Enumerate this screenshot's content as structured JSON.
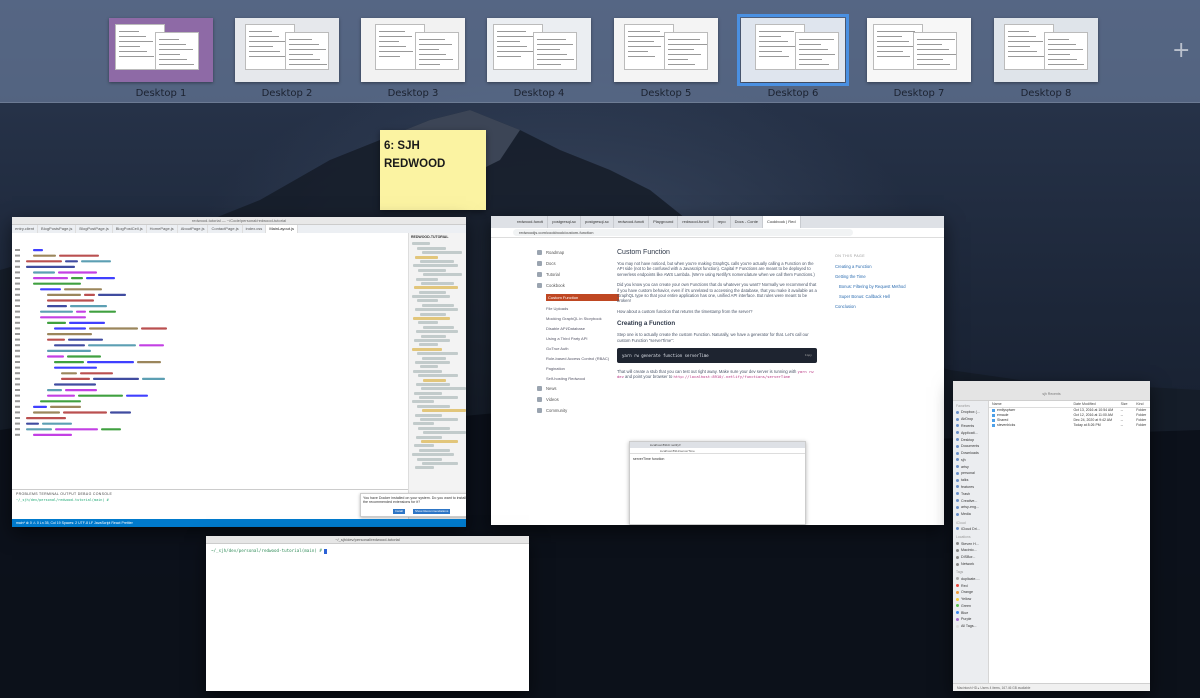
{
  "spaces": {
    "desktops": [
      {
        "label": "Desktop 1",
        "active": false,
        "tint": "#8e6aa6"
      },
      {
        "label": "Desktop 2",
        "active": false,
        "tint": "#e6e8ec"
      },
      {
        "label": "Desktop 3",
        "active": false,
        "tint": "#f2f2f2"
      },
      {
        "label": "Desktop 4",
        "active": false,
        "tint": "#ebeef2"
      },
      {
        "label": "Desktop 5",
        "active": false,
        "tint": "#f4f4f4"
      },
      {
        "label": "Desktop 6",
        "active": true,
        "tint": "#dfe5ee"
      },
      {
        "label": "Desktop 7",
        "active": false,
        "tint": "#f7f7f7"
      },
      {
        "label": "Desktop 8",
        "active": false,
        "tint": "#dfe4ea"
      }
    ],
    "add_icon": "plus-icon",
    "add_glyph": "+"
  },
  "sticky": {
    "text": "6: SJH REDWOOD"
  },
  "vscode": {
    "title": "redwood-tutorial — ~/Code/personal/redwood-tutorial",
    "tabs": [
      "entry.client",
      "BlogPostsPage.js",
      "BlogPostPage.js",
      "BlogPostCell.js",
      "HomePage.js",
      "AboutPage.js",
      "ContactPage.js",
      "index.css",
      "MainLayout.js"
    ],
    "explorer_header": "REDWOOD-TUTORIAL",
    "panel_tabs": "PROBLEMS  TERMINAL  OUTPUT  DEBUG CONSOLE",
    "prompt": "~/_sjh/dev/personal/redwood-tutorial(main) #",
    "status": "main*  ⊗ 0 ⚠ 0    Ln 35, Col 19   Spaces: 2   UTF-8   LF   JavaScript React   Prettier",
    "toast_text": "You have Docker installed on your system. Do you want to install the recommended extensions for it?",
    "toast_install": "Install",
    "toast_show": "Show Recommendations"
  },
  "chrome": {
    "tabs": [
      "redwood-functi",
      "postgresql-sc",
      "postgresql-sc",
      "redwood-functi",
      "Playground",
      "redwood-functi",
      "repo",
      "Docs - Conte",
      "Cookbook | Red"
    ],
    "url": "redwoodjs.com/cookbook/custom-function",
    "nav": {
      "main": [
        "Roadmap",
        "Docs",
        "Tutorial",
        "Cookbook"
      ],
      "sub": [
        "Custom Function",
        "File Uploads",
        "Mocking GraphQL in Storybook",
        "Disable API/Database",
        "Using a Third Party API",
        "GoTrue Auth",
        "Role-based Access Control (RBAC)",
        "Pagination",
        "Self-hosting Redwood"
      ],
      "bottom": [
        "News",
        "Videos",
        "Community"
      ]
    },
    "article": {
      "title": "Custom Function",
      "p1": "You may not have noticed, but when you're making GraphQL calls you're actually calling a Function on the API side (not to be confused with a Javascript function). Capital F Functions are meant to be deployed to serverless endpoints like AWS Lambda. (We're using Netlify's nomenclature when we call them Functions.)",
      "p2": "Did you know you can create your own Functions that do whatever you want? Normally we recommend that if you have custom behavior, even if it's unrelated to accessing the database, that you make it available as a GraphQL type so that your entire application has one, unified API interface. But rules were meant to be broken!",
      "p3": "How about a custom function that returns the timestamp from the server?",
      "h2": "Creating a Function",
      "p4": "Step one is to actually create the custom Function. Naturally, we have a generator for that. Let's call our custom Function \"serverTime\":",
      "code": "yarn rw generate function serverTime",
      "copy": "Copy",
      "p5a": "That will create a stub that you can test out right away. Make sure your dev server is running with",
      "code2": "yarn rw dev",
      "p5b": "and point your browser to",
      "code3": "http://localhost:8910/.netlify/functions/serverTime"
    },
    "toc": {
      "header": "ON THIS PAGE",
      "items": [
        "Creating a Function",
        "Getting the Time",
        "Bonus: Filtering by Request Method",
        "Super Bonus: Callback Hell",
        "Conclusion"
      ]
    },
    "embed": {
      "tab": "localhost:8910/.netlify/f",
      "url": "localhost:8911/serverTime",
      "content": "serverTime function"
    }
  },
  "terminal": {
    "title": "~/_sjh/dev/personal/redwood-tutorial",
    "prompt": "~/_sjh/dev/personal/redwood-tutorial(main) #"
  },
  "finder": {
    "path": "sjh        Recents",
    "favorites_header": "Favorites",
    "favorites": [
      "Dropbox (...",
      "AirDrop",
      "Recents",
      "Applicati...",
      "Desktop",
      "Documents",
      "Downloads",
      "sjh",
      "artsy",
      "personal",
      "talks",
      "features",
      "Trash",
      "Creative...",
      "artsy-eng...",
      "Media"
    ],
    "icloud_header": "iCloud",
    "icloud": [
      "iCloud Dri..."
    ],
    "locations_header": "Locations",
    "locations": [
      "Steven H...",
      "Macinto...",
      "DISBor...",
      "Network"
    ],
    "tags_header": "Tags",
    "tags": [
      {
        "label": "duplicate-...",
        "color": "#aaaaaa"
      },
      {
        "label": "Red",
        "color": "#e5483f"
      },
      {
        "label": "Orange",
        "color": "#f29a38"
      },
      {
        "label": "Yellow",
        "color": "#f4cd3b"
      },
      {
        "label": "Green",
        "color": "#5cc252"
      },
      {
        "label": "Blue",
        "color": "#3c8cf0"
      },
      {
        "label": "Purple",
        "color": "#a36ed0"
      },
      {
        "label": "All Tags...",
        "color": "#dddddd"
      }
    ],
    "columns": [
      "Name",
      "Date Modified",
      "Size",
      "Kind"
    ],
    "rows": [
      {
        "name": "emilyspiwer",
        "date": "Oct 13, 2016 at 10:54 AM",
        "size": "--",
        "kind": "Folder"
      },
      {
        "name": "emaule",
        "date": "Oct 12, 2016 at 11:00 AM",
        "size": "--",
        "kind": "Folder"
      },
      {
        "name": "Shared",
        "date": "Dec 24, 2020 at 9:42 AM",
        "size": "--",
        "kind": "Folder"
      },
      {
        "name": "stevenhicks",
        "date": "Today at 8:26 PM",
        "size": "--",
        "kind": "Folder"
      }
    ],
    "status": "Macintosh HD ▸ Users       4 items, 167.46 GB available"
  }
}
